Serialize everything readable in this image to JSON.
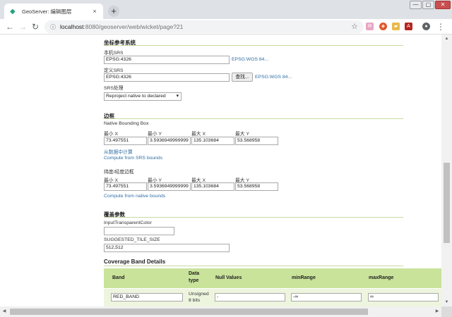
{
  "browser": {
    "tab_title": "GeoServer: 编辑图层",
    "tab_close": "×",
    "new_tab": "+",
    "url_host": "localhost",
    "url_path": ":8080/geoserver/web/wicket/page?21",
    "win_min": "—",
    "win_max": "▢",
    "win_close": "✕"
  },
  "crs": {
    "title": "坐标参考系统",
    "native_label": "本机SRS",
    "native_value": "EPSG:4326",
    "native_link": "EPSG:WGS 84...",
    "declared_label": "定义SRS",
    "declared_value": "EPSG:4326",
    "find_button": "查找...",
    "declared_link": "EPSG:WGS 84...",
    "handling_label": "SRS处理",
    "handling_value": "Reproject native to declared"
  },
  "bbox": {
    "title": "边框",
    "native_label": "Native Bounding Box",
    "col_labels": [
      "最小 X",
      "最小 Y",
      "最大 X",
      "最大 Y"
    ],
    "native_values": [
      "73.497551",
      "3.5936949999999",
      "135.103684",
      "53.568958"
    ],
    "compute_from_data": "从数据中计算",
    "compute_from_srs": "Compute from SRS bounds",
    "latlon_label": "纬度/经度边框",
    "latlon_values": [
      "73.497551",
      "3.5936949999999",
      "135.103684",
      "53.568958"
    ],
    "compute_from_native": "Compute from native bounds"
  },
  "coverage": {
    "title": "覆盖参数",
    "transparent_label": "InputTransparentColor",
    "transparent_value": "",
    "tile_label": "SUGGESTED_TILE_SIZE",
    "tile_value": "512,512"
  },
  "bands": {
    "title": "Coverage Band Details",
    "headers": {
      "band": "Band",
      "data_type_1": "Data",
      "data_type_2": "type",
      "null_values": "Null Values",
      "min_range": "minRange",
      "max_range": "maxRange"
    },
    "rows": [
      {
        "band": "RED_BAND",
        "type_1": "Unsigned",
        "type_2": "8 bits",
        "null_value": "-",
        "min": "-∞",
        "max": "∞"
      }
    ]
  }
}
